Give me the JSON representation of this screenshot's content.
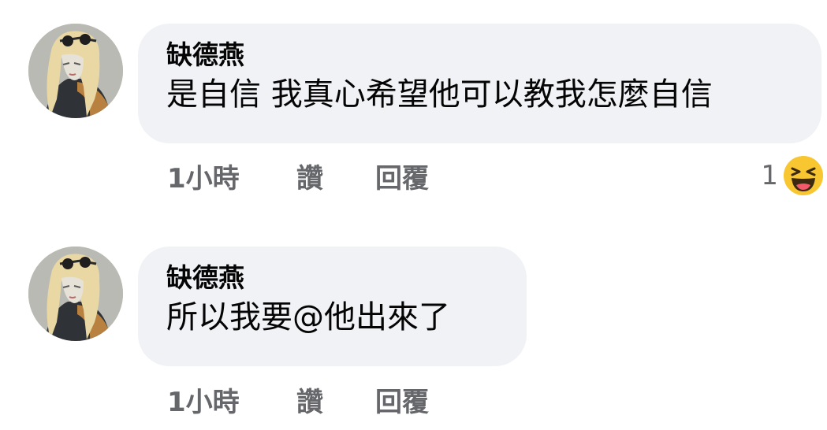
{
  "comments": [
    {
      "author": "缺德燕",
      "text": "是自信 我真心希望他可以教我怎麼自信",
      "time": "1小時",
      "like_label": "讚",
      "reply_label": "回覆",
      "reaction": {
        "count": "1",
        "icon": "haha-emoji-icon"
      }
    },
    {
      "author": "缺德燕",
      "text": "所以我要@他出來了",
      "time": "1小時",
      "like_label": "讚",
      "reply_label": "回覆"
    }
  ],
  "colors": {
    "bubble_bg": "#f0f2f5",
    "text": "#050505",
    "secondary_text": "#65676b"
  }
}
